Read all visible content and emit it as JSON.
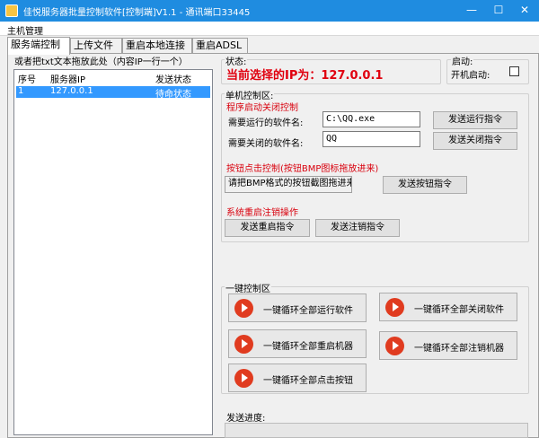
{
  "window": {
    "title": "佳悦服务器批量控制软件[控制端]V1.1 - 通讯端口33445",
    "min_glyph": "—",
    "max_glyph": "☐",
    "close_glyph": "✕"
  },
  "menu": {
    "item": "主机管理"
  },
  "tabs": [
    "服务端控制",
    "上传文件",
    "重启本地连接",
    "重启ADSL"
  ],
  "server_list": {
    "hint": "或者把txt文本拖放此处（内容IP一行一个）",
    "columns": [
      "序号",
      "服务器IP",
      "发送状态"
    ],
    "rows": [
      {
        "index": "1",
        "ip": "127.0.0.1",
        "status": "待命状态"
      }
    ]
  },
  "status": {
    "label": "状态:",
    "current_ip": "当前选择的IP为：127.0.0.1"
  },
  "startup": {
    "label": "启动:",
    "checkbox_label": "开机启动:",
    "checked": false
  },
  "single": {
    "label": "单机控制区:",
    "program_section": "程序启动关闭控制",
    "run_label": "需要运行的软件名:",
    "run_value": "C:\\QQ.exe",
    "run_button": "发送运行指令",
    "close_label": "需要关闭的软件名:",
    "close_value": "QQ",
    "close_button": "发送关闭指令",
    "click_section": "按钮点击控制(按钮BMP图标拖放进来)",
    "bmp_hint": "请把BMP格式的按钮截图拖进来",
    "click_button": "发送按钮指令",
    "restart_section": "系统重启注销操作",
    "restart_button": "发送重启指令",
    "logoff_button": "发送注销指令"
  },
  "oneclick": {
    "label": "一键控制区",
    "run_all": "一键循环全部运行软件",
    "close_all": "一键循环全部关闭软件",
    "restart_all": "一键循环全部重启机器",
    "logoff_all": "一键循环全部注销机器",
    "click_all": "一键循环全部点击按钮"
  },
  "progress": {
    "label": "发送进度:",
    "value": 0
  }
}
